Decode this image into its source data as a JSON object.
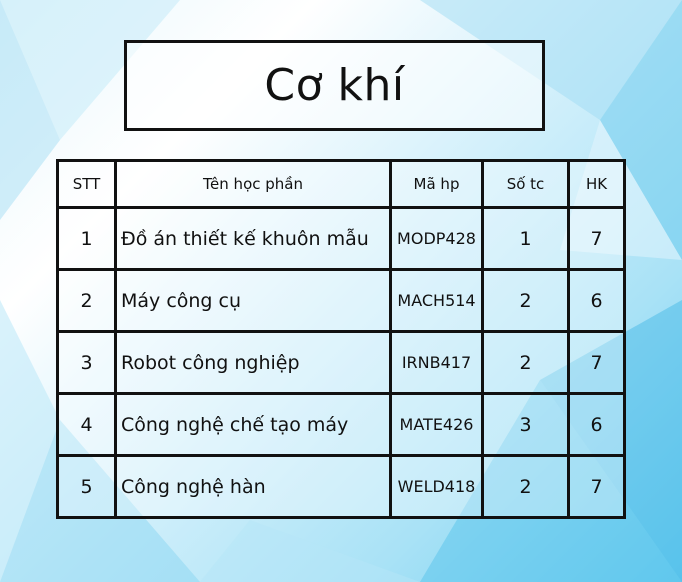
{
  "title": "Cơ khí",
  "table": {
    "headers": [
      "STT",
      "Tên học phần",
      "Mã hp",
      "Số tc",
      "HK"
    ],
    "rows": [
      {
        "stt": "1",
        "name": "Đồ án thiết kế khuôn mẫu",
        "code": "MODP428",
        "credits": "1",
        "semester": "7"
      },
      {
        "stt": "2",
        "name": "Máy công cụ",
        "code": "MACH514",
        "credits": "2",
        "semester": "6"
      },
      {
        "stt": "3",
        "name": "Robot công nghiệp",
        "code": "IRNB417",
        "credits": "2",
        "semester": "7"
      },
      {
        "stt": "4",
        "name": "Công nghệ chế tạo máy",
        "code": "MATE426",
        "credits": "3",
        "semester": "6"
      },
      {
        "stt": "5",
        "name": "Công nghệ hàn",
        "code": "WELD418",
        "credits": "2",
        "semester": "7"
      }
    ]
  },
  "colors": {
    "background_light": "#e8f7fd",
    "background_accent": "#6dcdef",
    "border": "#111111"
  }
}
